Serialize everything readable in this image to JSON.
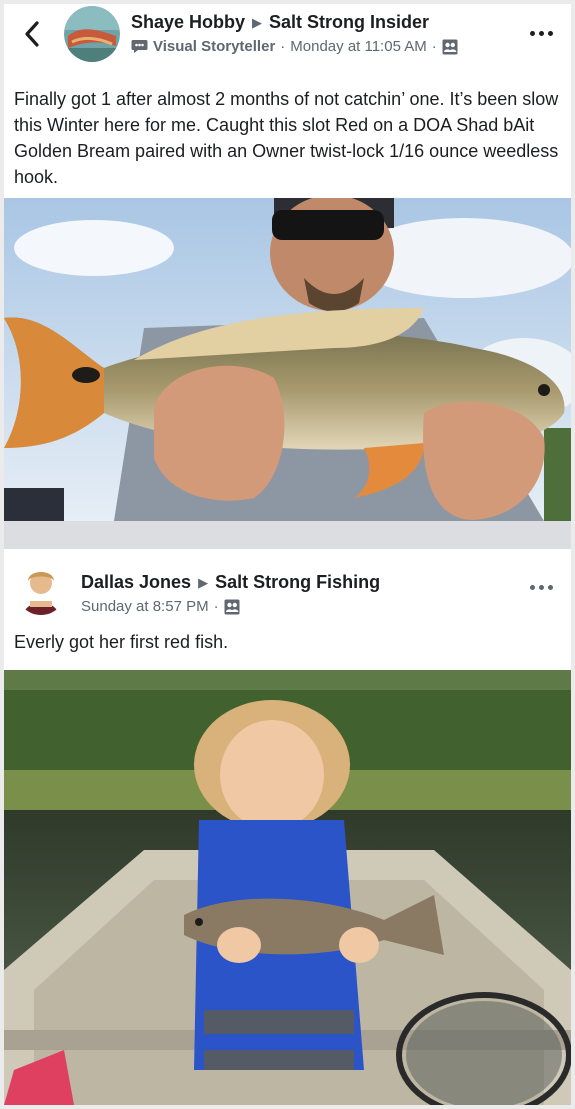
{
  "post1": {
    "author": "Shaye Hobby",
    "group": "Salt Strong Insider",
    "badge": "Visual Storyteller",
    "time": "Monday at 11:05 AM",
    "text": "Finally got 1 after almost 2 months of not catchin’ one. It’s been slow this Winter here for me. Caught this slot Red on a DOA Shad bAit Golden Bream paired with an Owner twist-lock 1/16 ounce weedless hook."
  },
  "post2": {
    "author": "Dallas Jones",
    "group": "Salt Strong Fishing",
    "time": "Sunday at 8:57 PM",
    "text": "Everly got her first red fish."
  },
  "separator": "·",
  "icons": {
    "back": "chevron-left-icon",
    "more": "more-dots-icon",
    "arrow": "right-triangle-icon",
    "badge": "chat-bubble-icon",
    "audience": "group-audience-icon"
  }
}
